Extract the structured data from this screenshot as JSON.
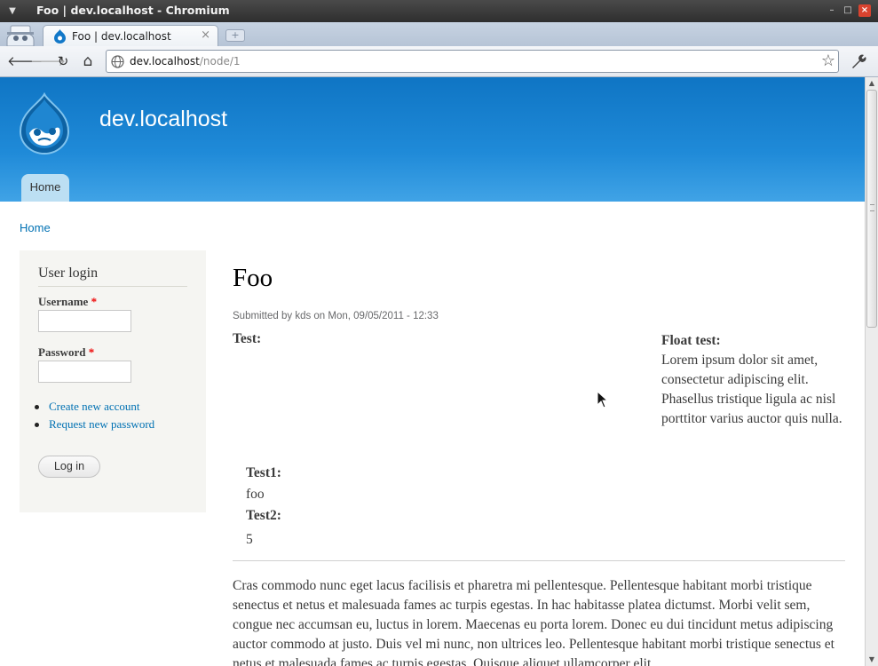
{
  "window": {
    "title": "Foo | dev.localhost - Chromium"
  },
  "tab": {
    "title": "Foo | dev.localhost",
    "close_glyph": "×",
    "newtab_glyph": "+"
  },
  "toolbar": {
    "back_glyph": "🡐",
    "forward_glyph": "🡒",
    "reload_glyph": "↻",
    "home_glyph": "⌂",
    "url_host": "dev.localhost",
    "url_path": "/node/1",
    "bookmark_glyph": "☆"
  },
  "site": {
    "name": "dev.localhost",
    "nav_home": "Home"
  },
  "breadcrumb": "Home",
  "login": {
    "title": "User login",
    "username_label": "Username",
    "password_label": "Password",
    "required_mark": "*",
    "username_value": "",
    "password_value": "",
    "links": [
      "Create new account",
      "Request new password"
    ],
    "submit_label": "Log in"
  },
  "node": {
    "title": "Foo",
    "submitted": "Submitted by kds on Mon, 09/05/2011 - 12:33",
    "test_label": "Test:",
    "float_label": "Float test:",
    "float_text": "Lorem ipsum dolor sit amet, consectetur adipiscing elit. Phasellus tristique ligula ac nisl porttitor varius auctor quis nulla.",
    "test1_label": "Test1:",
    "test1_value": "foo",
    "test2_label": "Test2:",
    "test2_value": "5",
    "body": "Cras commodo nunc eget lacus facilisis et pharetra mi pellentesque. Pellentesque habitant morbi tristique senectus et netus et malesuada fames ac turpis egestas. In hac habitasse platea dictumst. Morbi velit sem, congue nec accumsan eu, luctus in lorem. Maecenas eu porta lorem. Donec eu dui tincidunt metus adipiscing auctor commodo at justo. Duis vel mi nunc, non ultrices leo. Pellentesque habitant morbi tristique senectus et netus et malesuada fames ac turpis egestas. Quisque aliquet ullamcorper elit"
  },
  "colors": {
    "header_top": "#0f75c4",
    "header_bottom": "#40a3e6",
    "link": "#0071b3",
    "sidebar_bg": "#f5f5f2",
    "required": "#ee0000"
  }
}
